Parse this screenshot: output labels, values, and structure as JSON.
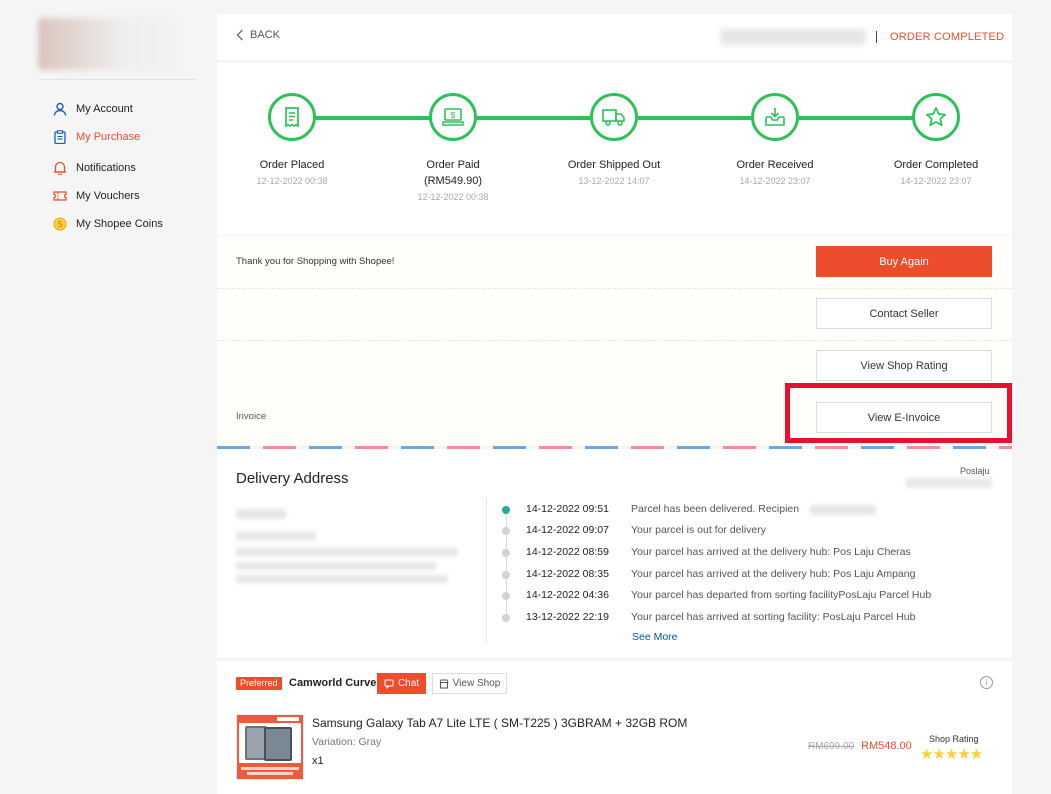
{
  "sidebar": {
    "items": [
      {
        "label": "My Account",
        "icon": "user-icon"
      },
      {
        "label": "My Purchase",
        "icon": "clipboard-icon",
        "active": true
      },
      {
        "label": "Notifications",
        "icon": "bell-icon"
      },
      {
        "label": "My Vouchers",
        "icon": "ticket-icon"
      },
      {
        "label": "My Shopee Coins",
        "icon": "coin-icon"
      }
    ]
  },
  "header": {
    "back_label": "BACK",
    "status": "ORDER COMPLETED"
  },
  "tracker": {
    "steps": [
      {
        "label": "Order Placed",
        "sub": "",
        "date": "12-12-2022 00:38",
        "icon": "receipt-icon"
      },
      {
        "label": "Order Paid",
        "sub": "(RM549.90)",
        "date": "12-12-2022 00:38",
        "icon": "money-icon"
      },
      {
        "label": "Order Shipped Out",
        "sub": "",
        "date": "13-12-2022 14:07",
        "icon": "truck-icon"
      },
      {
        "label": "Order Received",
        "sub": "",
        "date": "14-12-2022 23:07",
        "icon": "inbox-download-icon"
      },
      {
        "label": "Order Completed",
        "sub": "",
        "date": "14-12-2022 23:07",
        "icon": "star-icon"
      }
    ]
  },
  "actions": {
    "thank_you": "Thank you for Shopping with Shopee!",
    "buy_again": "Buy Again",
    "contact_seller": "Contact Seller",
    "view_shop_rating": "View Shop Rating",
    "invoice_label": "Invoice",
    "view_einvoice": "View E-Invoice"
  },
  "delivery": {
    "title": "Delivery Address",
    "courier": "Poslaju",
    "events": [
      {
        "time": "14-12-2022 09:51",
        "desc": "Parcel has been delivered. Recipien",
        "active": true
      },
      {
        "time": "14-12-2022 09:07",
        "desc": "Your parcel is out for delivery"
      },
      {
        "time": "14-12-2022 08:59",
        "desc": "Your parcel has arrived at the delivery hub: Pos Laju Cheras"
      },
      {
        "time": "14-12-2022 08:35",
        "desc": "Your parcel has arrived at the delivery hub: Pos Laju Ampang"
      },
      {
        "time": "14-12-2022 04:36",
        "desc": "Your parcel has departed from sorting facilityPosLaju Parcel Hub"
      },
      {
        "time": "13-12-2022 22:19",
        "desc": "Your parcel has arrived at sorting facility: PosLaju Parcel Hub"
      }
    ],
    "see_more": "See More"
  },
  "shop": {
    "badge": "Preferred",
    "name": "Camworld Curve",
    "chat": "Chat",
    "view_shop": "View Shop"
  },
  "product": {
    "title": "Samsung Galaxy Tab A7 Lite LTE ( SM-T225 ) 3GBRAM + 32GB ROM",
    "variation": "Variation: Gray",
    "qty": "x1",
    "price_old": "RM699.00",
    "price_new": "RM548.00",
    "rating_label": "Shop Rating",
    "stars": "★★★★★",
    "rating_value": 5
  },
  "colors": {
    "accent": "#ee4d2d",
    "progress": "#2dc258",
    "highlight": "#e8112d"
  }
}
